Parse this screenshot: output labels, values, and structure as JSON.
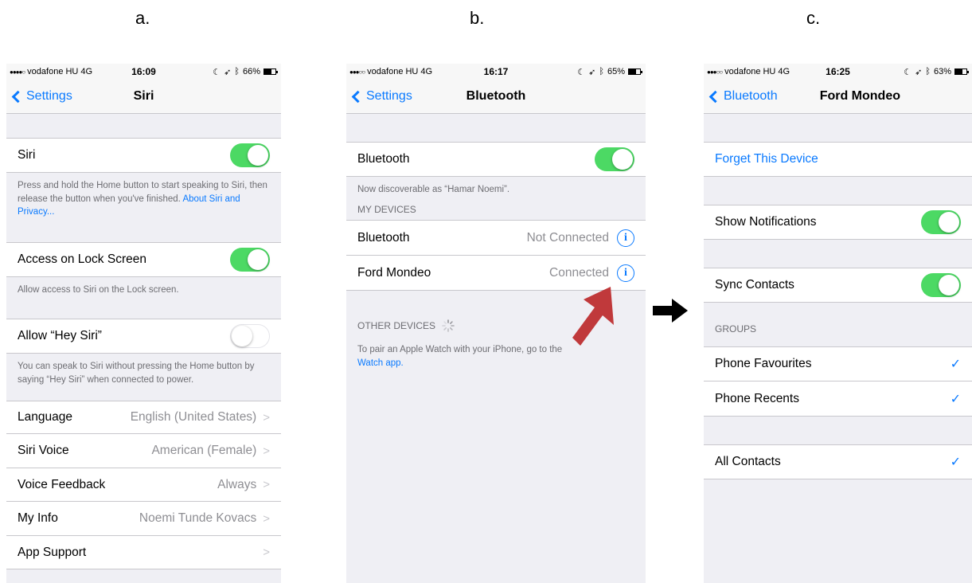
{
  "labels": {
    "a": "a.",
    "b": "b.",
    "c": "c."
  },
  "colors": {
    "accent": "#0a7aff",
    "toggle_on": "#4cd964",
    "red_arrow": "#c0393b"
  },
  "screen_a": {
    "status": {
      "carrier": "vodafone HU",
      "network": "4G",
      "time": "16:09",
      "battery": "66%",
      "battery_level": 0.66
    },
    "nav": {
      "back": "Settings",
      "title": "Siri"
    },
    "siri_label": "Siri",
    "siri_footer": "Press and hold the Home button to start speaking to Siri, then release the button when you've finished.",
    "siri_footer_link": "About Siri and Privacy...",
    "lock_label": "Access on Lock Screen",
    "lock_footer": "Allow access to Siri on the Lock screen.",
    "hey_label": "Allow “Hey Siri”",
    "hey_footer": "You can speak to Siri without pressing the Home button by saying “Hey Siri” when connected to power.",
    "items": [
      {
        "label": "Language",
        "value": "English (United States)"
      },
      {
        "label": "Siri Voice",
        "value": "American (Female)"
      },
      {
        "label": "Voice Feedback",
        "value": "Always"
      },
      {
        "label": "My Info",
        "value": "Noemi Tunde Kovacs"
      },
      {
        "label": "App Support",
        "value": ""
      }
    ]
  },
  "screen_b": {
    "status": {
      "carrier": "vodafone HU",
      "network": "4G",
      "time": "16:17",
      "battery": "65%",
      "battery_level": 0.65
    },
    "nav": {
      "back": "Settings",
      "title": "Bluetooth"
    },
    "bt_label": "Bluetooth",
    "discoverable": "Now discoverable as “Hamar Noemi”.",
    "my_devices_header": "MY DEVICES",
    "devices": [
      {
        "name": "Bluetooth",
        "status": "Not Connected"
      },
      {
        "name": "Ford Mondeo",
        "status": "Connected"
      }
    ],
    "other_devices_header": "OTHER DEVICES",
    "pair_text": "To pair an Apple Watch with your iPhone, go to the",
    "pair_link": "Watch app."
  },
  "screen_c": {
    "status": {
      "carrier": "vodafone HU",
      "network": "4G",
      "time": "16:25",
      "battery": "63%",
      "battery_level": 0.63
    },
    "nav": {
      "back": "Bluetooth",
      "title": "Ford Mondeo"
    },
    "forget": "Forget This Device",
    "show_notifications": "Show Notifications",
    "sync_contacts": "Sync Contacts",
    "groups_header": "GROUPS",
    "groups": [
      "Phone Favourites",
      "Phone Recents"
    ],
    "all_contacts": "All Contacts"
  }
}
